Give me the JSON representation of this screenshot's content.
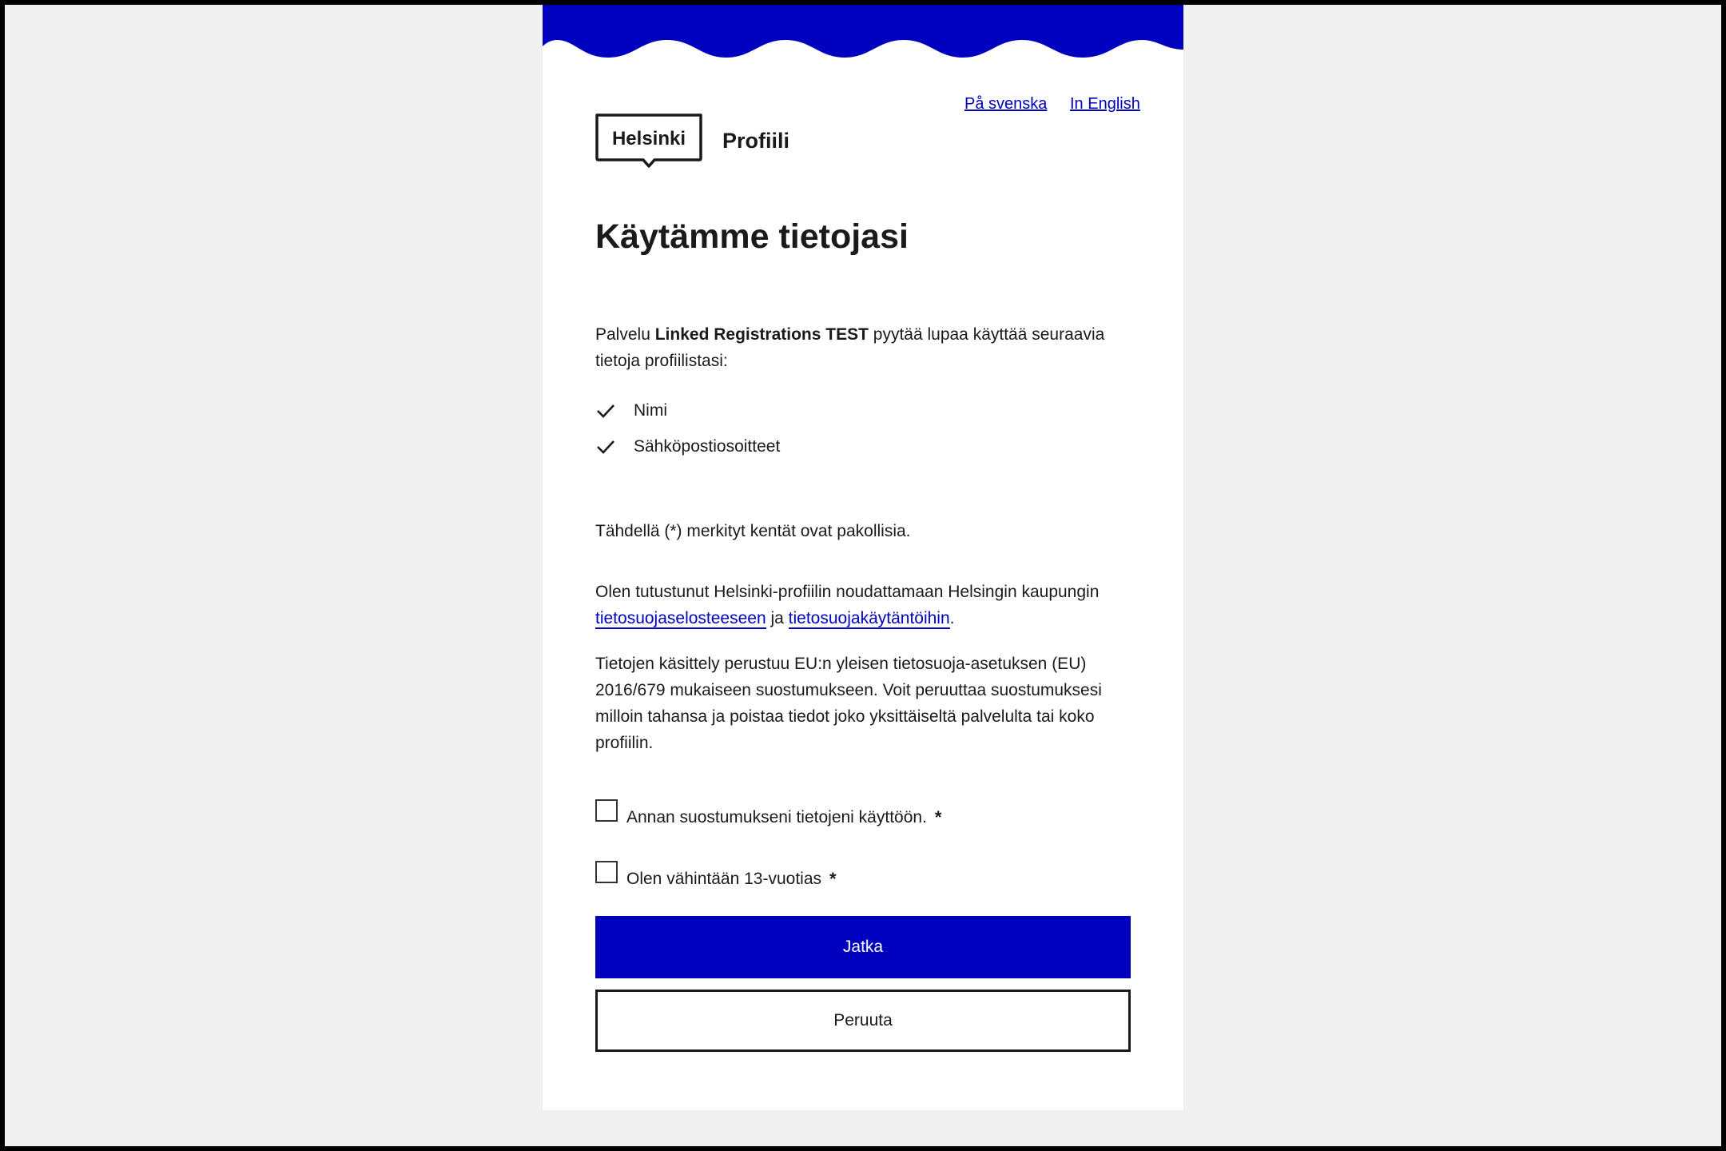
{
  "brand": {
    "logo_text": "Helsinki",
    "app_name": "Profiili",
    "accent_color": "#0000bf"
  },
  "languages": {
    "swedish": "På svenska",
    "english": "In English"
  },
  "page": {
    "title": "Käytämme tietojasi"
  },
  "intro": {
    "prefix": "Palvelu ",
    "service_name": "Linked Registrations TEST",
    "suffix": " pyytää lupaa käyttää seuraavia tietoja profiilistasi:"
  },
  "permissions": [
    "Nimi",
    "Sähköpostiosoitteet"
  ],
  "required_note": "Tähdellä (*) merkityt kentät ovat pakollisia.",
  "consent": {
    "prefix": "Olen tutustunut Helsinki-profiilin noudattamaan Helsingin kaupungin ",
    "link1": "tietosuojaselosteeseen",
    "middle": " ja ",
    "link2": "tietosuojakäytäntöihin",
    "suffix": "."
  },
  "legal_text": "Tietojen käsittely perustuu EU:n yleisen tietosuoja-asetuksen (EU) 2016/679 mukaiseen suostumukseen. Voit peruuttaa suostumuksesi milloin tahansa ja poistaa tiedot joko yksittäiseltä palvelulta tai koko profiilin.",
  "checkboxes": [
    {
      "label": "Annan suostumukseni tietojeni käyttöön.",
      "required_mark": "*",
      "checked": false
    },
    {
      "label": "Olen vähintään 13-vuotias",
      "required_mark": "*",
      "checked": false
    }
  ],
  "buttons": {
    "continue": "Jatka",
    "cancel": "Peruuta"
  },
  "icons": {
    "permission": "check-icon"
  }
}
